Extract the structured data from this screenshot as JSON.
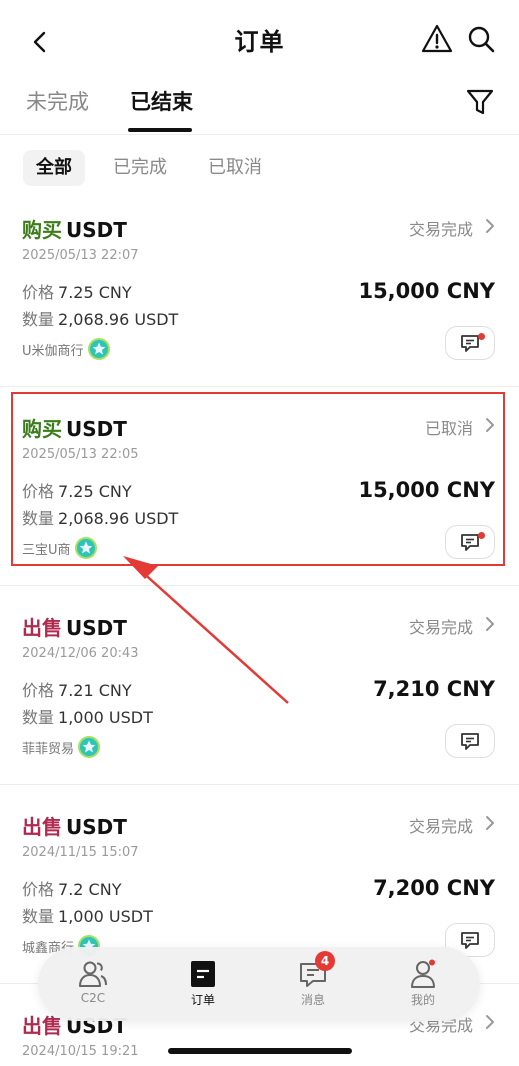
{
  "header": {
    "title": "订单"
  },
  "tabs": [
    {
      "label": "未完成",
      "active": false
    },
    {
      "label": "已结束",
      "active": true
    }
  ],
  "chips": [
    {
      "label": "全部",
      "active": true
    },
    {
      "label": "已完成",
      "active": false
    },
    {
      "label": "已取消",
      "active": false
    }
  ],
  "orders": [
    {
      "side": "购买",
      "asset": "USDT",
      "date": "2025/05/13 22:07",
      "status": "交易完成",
      "price_label": "价格",
      "price": "7.25 CNY",
      "qty_label": "数量",
      "qty": "2,068.96 USDT",
      "total": "15,000 CNY",
      "merchant": "U米伽商行",
      "chat_unread": true
    },
    {
      "side": "购买",
      "asset": "USDT",
      "date": "2025/05/13 22:05",
      "status": "已取消",
      "price_label": "价格",
      "price": "7.25 CNY",
      "qty_label": "数量",
      "qty": "2,068.96 USDT",
      "total": "15,000 CNY",
      "merchant": "三宝U商",
      "chat_unread": true
    },
    {
      "side": "出售",
      "asset": "USDT",
      "date": "2024/12/06 20:43",
      "status": "交易完成",
      "price_label": "价格",
      "price": "7.21 CNY",
      "qty_label": "数量",
      "qty": "1,000 USDT",
      "total": "7,210 CNY",
      "merchant": "菲菲贸易",
      "chat_unread": false
    },
    {
      "side": "出售",
      "asset": "USDT",
      "date": "2024/11/15 15:07",
      "status": "交易完成",
      "price_label": "价格",
      "price": "7.2 CNY",
      "qty_label": "数量",
      "qty": "1,000 USDT",
      "total": "7,200 CNY",
      "merchant": "城鑫商行",
      "chat_unread": false
    },
    {
      "side": "出售",
      "asset": "USDT",
      "date": "2024/10/15 19:21",
      "status": "交易完成"
    }
  ],
  "nav": [
    {
      "label": "C2C",
      "icon": "people-icon"
    },
    {
      "label": "订单",
      "icon": "order-icon",
      "active": true
    },
    {
      "label": "消息",
      "icon": "message-icon",
      "badge": "4"
    },
    {
      "label": "我的",
      "icon": "profile-icon"
    }
  ],
  "colors": {
    "buy": "#3a7d1a",
    "sell": "#b02a4f",
    "highlight": "#e53935"
  }
}
